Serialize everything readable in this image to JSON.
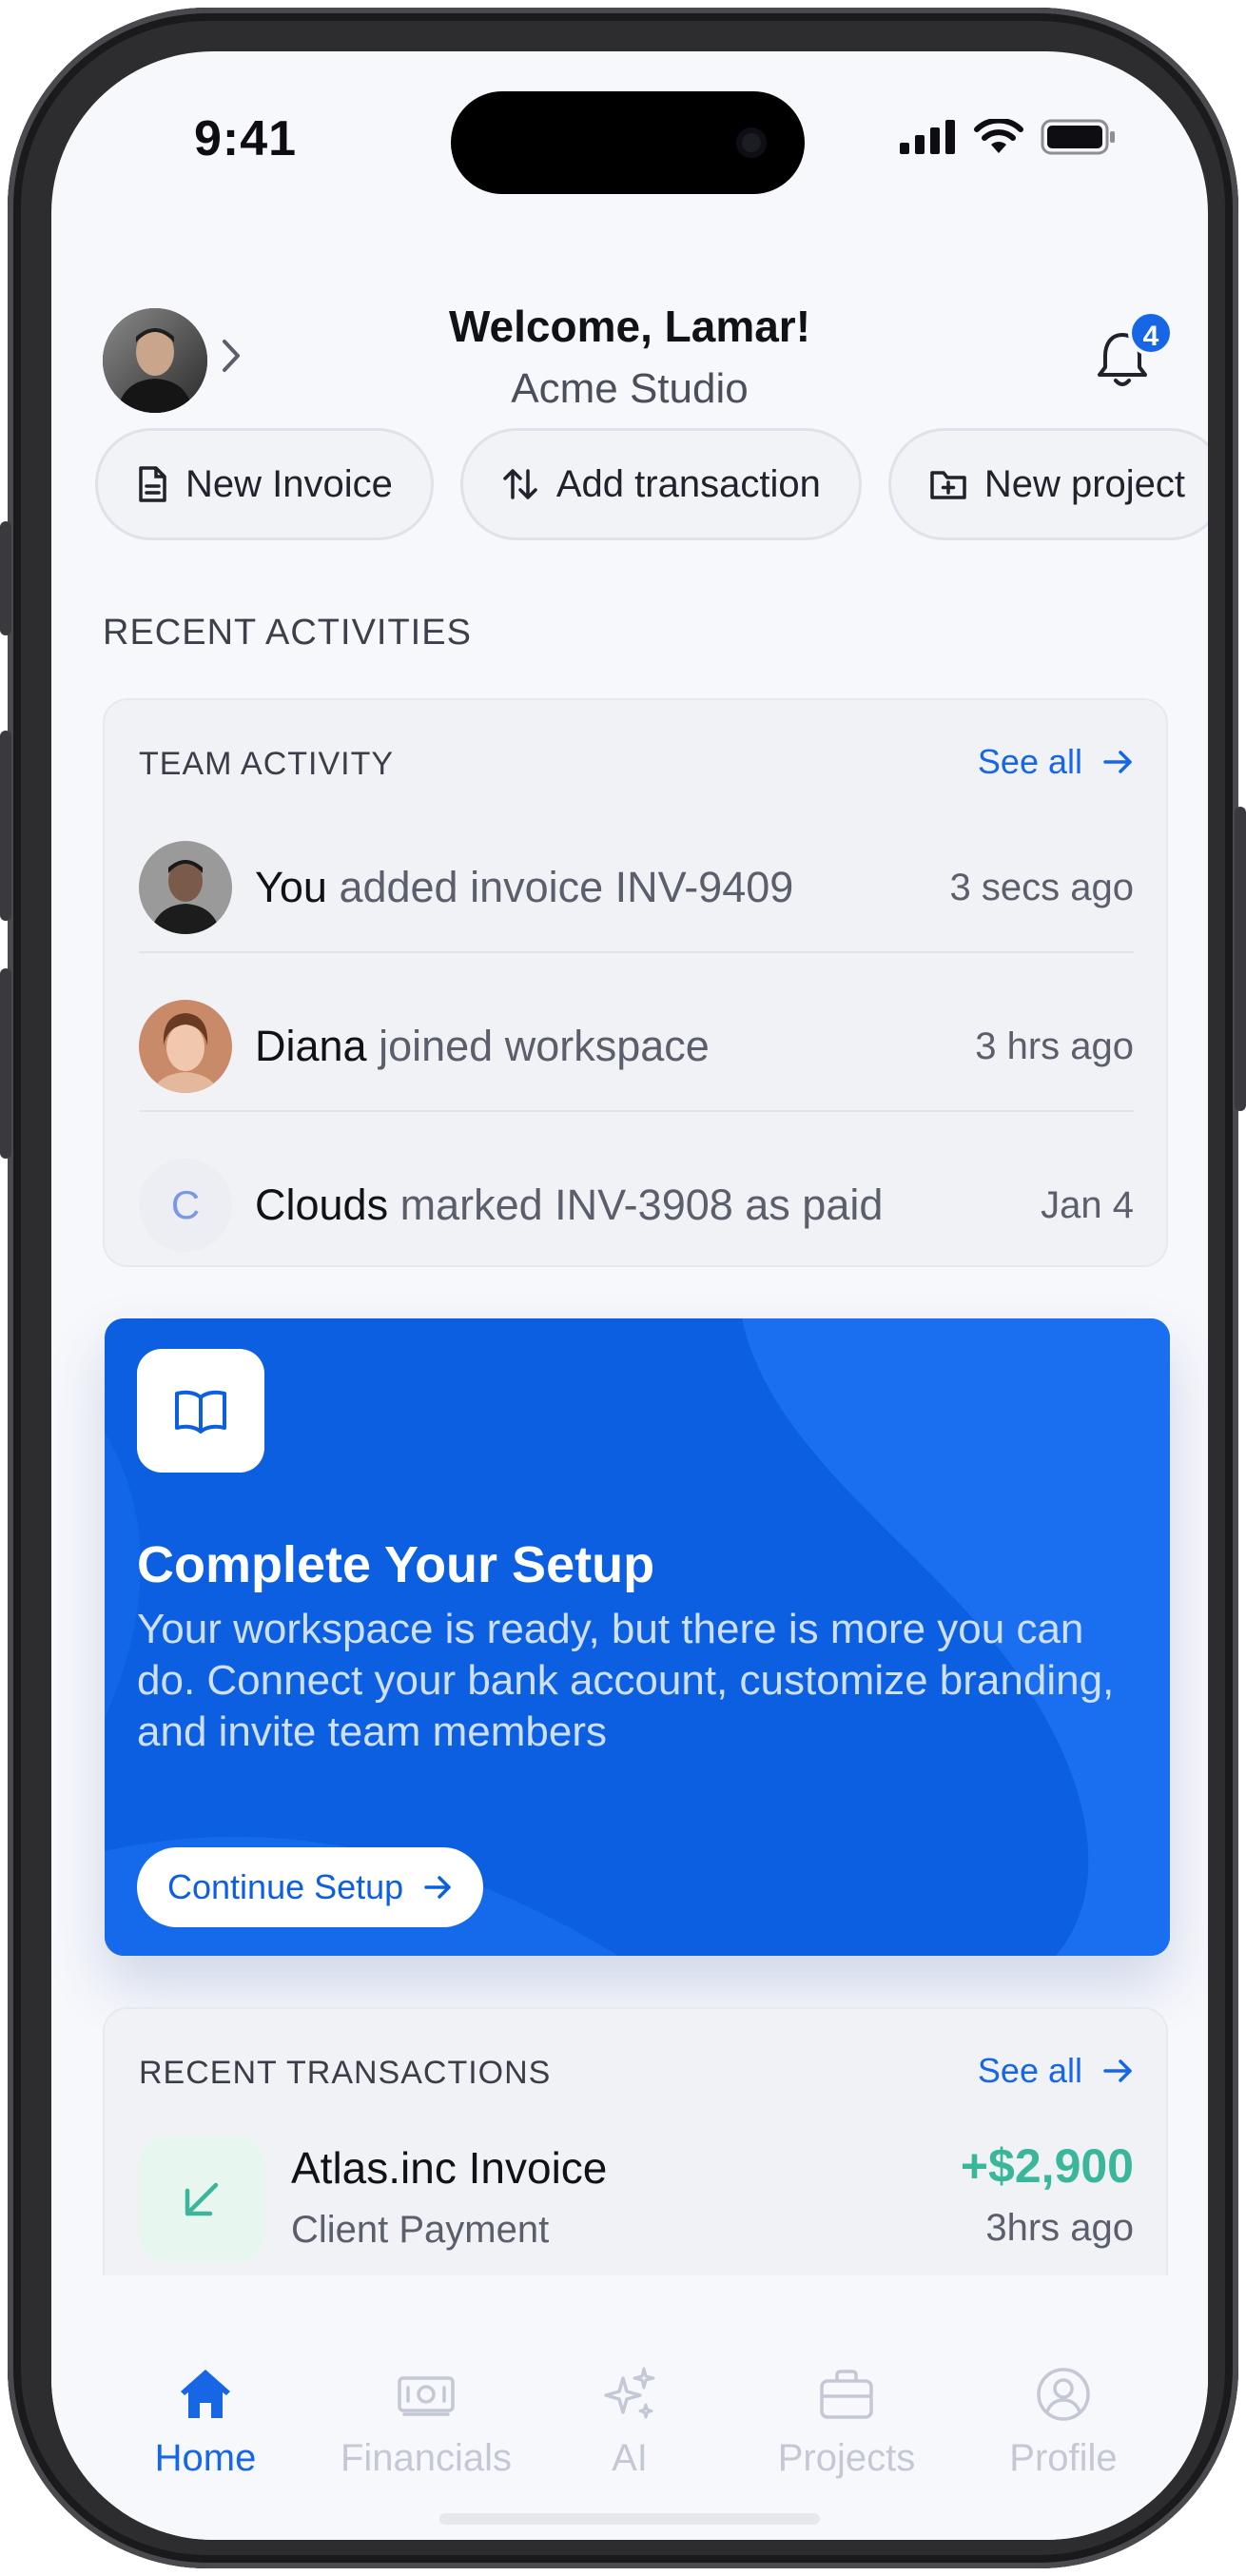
{
  "status_bar": {
    "time": "9:41"
  },
  "header": {
    "welcome": "Welcome, Lamar!",
    "workspace": "Acme Studio",
    "notification_count": "4"
  },
  "quick_actions": [
    {
      "label": "New Invoice",
      "icon": "file-icon"
    },
    {
      "label": "Add transaction",
      "icon": "arrows-updown-icon"
    },
    {
      "label": "New project",
      "icon": "folder-plus-icon"
    }
  ],
  "recent_activities": {
    "title": "RECENT ACTIVITIES",
    "team_activity": {
      "title": "TEAM ACTIVITY",
      "see_all": "See all",
      "items": [
        {
          "actor": "You",
          "action": "added invoice INV-9409",
          "time": "3 secs ago"
        },
        {
          "actor": "Diana",
          "action": "joined workspace",
          "time": "3 hrs ago"
        },
        {
          "actor": "Clouds",
          "initial": "C",
          "action": "marked INV-3908 as paid",
          "time": "Jan 4"
        }
      ]
    }
  },
  "setup_card": {
    "title": "Complete Your Setup",
    "description": "Your workspace is ready, but there is more you can do. Connect your bank account, customize branding, and invite team members",
    "button": "Continue Setup",
    "colors": {
      "background": "#0b5fe0",
      "highlight": "#1a6ff0"
    }
  },
  "recent_transactions": {
    "title": "RECENT TRANSACTIONS",
    "see_all": "See all",
    "items": [
      {
        "name": "Atlas.inc Invoice",
        "category": "Client Payment",
        "amount": "+$2,900",
        "time": "3hrs ago"
      }
    ]
  },
  "tab_bar": {
    "active": "Home",
    "tabs": [
      {
        "label": "Home",
        "icon": "home-icon"
      },
      {
        "label": "Financials",
        "icon": "cash-icon"
      },
      {
        "label": "AI",
        "icon": "sparkles-icon"
      },
      {
        "label": "Projects",
        "icon": "briefcase-icon"
      },
      {
        "label": "Profile",
        "icon": "user-circle-icon"
      }
    ]
  },
  "colors": {
    "accent": "#1666e6",
    "positive": "#3ab79a",
    "text": "#101218",
    "muted": "#5b5f6b"
  }
}
